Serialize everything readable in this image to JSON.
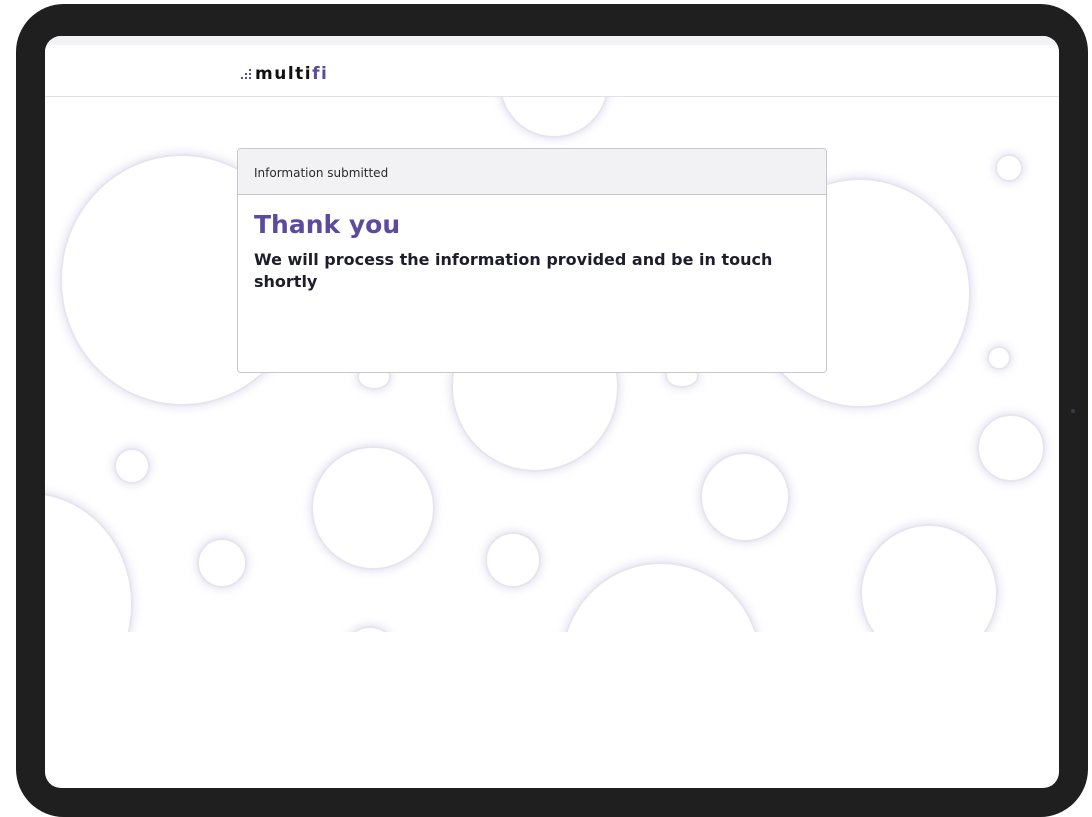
{
  "header": {
    "logo": {
      "part_a": "multi",
      "part_b": "fi"
    }
  },
  "card": {
    "header_label": "Information submitted",
    "title": "Thank you",
    "message": "We will process the information provided and be in touch shortly"
  },
  "colors": {
    "brand": "#5b4a9e",
    "frame": "#1f1f1f",
    "text_dark": "#1d1d2b"
  }
}
